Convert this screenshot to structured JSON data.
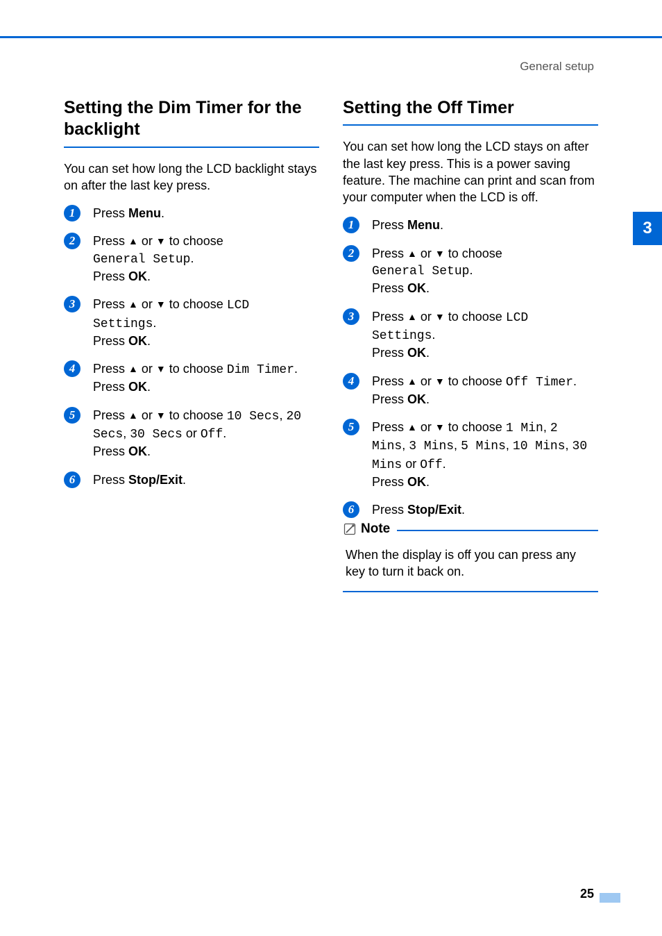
{
  "header": {
    "label": "General setup"
  },
  "pageNumber": "25",
  "sideTab": "3",
  "left": {
    "heading": "Setting the Dim Timer for the backlight",
    "intro": "You can set how long the LCD backlight stays on after the last key press.",
    "steps": {
      "s1": {
        "t1": "Press ",
        "b": "Menu",
        "t2": "."
      },
      "s2": {
        "t1": "Press ",
        "t2": " or ",
        "t3": " to choose ",
        "m": "General Setup",
        "t4": ".",
        "t5": "Press ",
        "b": "OK",
        "t6": "."
      },
      "s3": {
        "t1": "Press ",
        "t2": " or ",
        "t3": " to choose ",
        "m": "LCD Settings",
        "t4": ".",
        "t5": "Press ",
        "b": "OK",
        "t6": "."
      },
      "s4": {
        "t1": "Press ",
        "t2": " or ",
        "t3": " to choose ",
        "m": "Dim Timer",
        "t4": ".",
        "t5": "Press ",
        "b": "OK",
        "t6": "."
      },
      "s5": {
        "t1": "Press ",
        "t2": " or ",
        "t3": " to choose ",
        "m1": "10 Secs",
        "c1": ", ",
        "m2": "20 Secs",
        "c2": ", ",
        "m3": "30 Secs",
        "c3": " or ",
        "m4": "Off",
        "t4": ".",
        "t5": "Press ",
        "b": "OK",
        "t6": "."
      },
      "s6": {
        "t1": "Press ",
        "b": "Stop/Exit",
        "t2": "."
      }
    }
  },
  "right": {
    "heading": "Setting the Off Timer",
    "intro": "You can set how long the LCD stays on after the last key press. This is a power saving feature. The machine can print and scan from your computer when the LCD is off.",
    "steps": {
      "s1": {
        "t1": "Press ",
        "b": "Menu",
        "t2": "."
      },
      "s2": {
        "t1": "Press ",
        "t2": " or ",
        "t3": " to choose ",
        "m": "General Setup",
        "t4": ".",
        "t5": "Press ",
        "b": "OK",
        "t6": "."
      },
      "s3": {
        "t1": "Press ",
        "t2": " or ",
        "t3": " to choose ",
        "m": "LCD Settings",
        "t4": ".",
        "t5": "Press ",
        "b": "OK",
        "t6": "."
      },
      "s4": {
        "t1": "Press ",
        "t2": " or ",
        "t3": " to choose ",
        "m": "Off Timer",
        "t4": ".",
        "t5": "Press ",
        "b": "OK",
        "t6": "."
      },
      "s5": {
        "t1": "Press ",
        "t2": " or ",
        "t3": " to choose ",
        "m1": "1 Min",
        "c1": ", ",
        "m2": "2 Mins",
        "c2": ", ",
        "m3": "3 Mins",
        "c3": ", ",
        "m4": "5 Mins",
        "c4": ", ",
        "m5": "10 Mins",
        "c5": ", ",
        "m6": "30 Mins",
        "c6": " or ",
        "m7": "Off",
        "t4": ".",
        "t5": "Press ",
        "b": "OK",
        "t6": "."
      },
      "s6": {
        "t1": "Press ",
        "b": "Stop/Exit",
        "t2": "."
      }
    },
    "note": {
      "title": "Note",
      "body": "When the display is off you can press any key to turn it back on."
    }
  },
  "arrows": {
    "up": "▲",
    "down": "▼"
  }
}
